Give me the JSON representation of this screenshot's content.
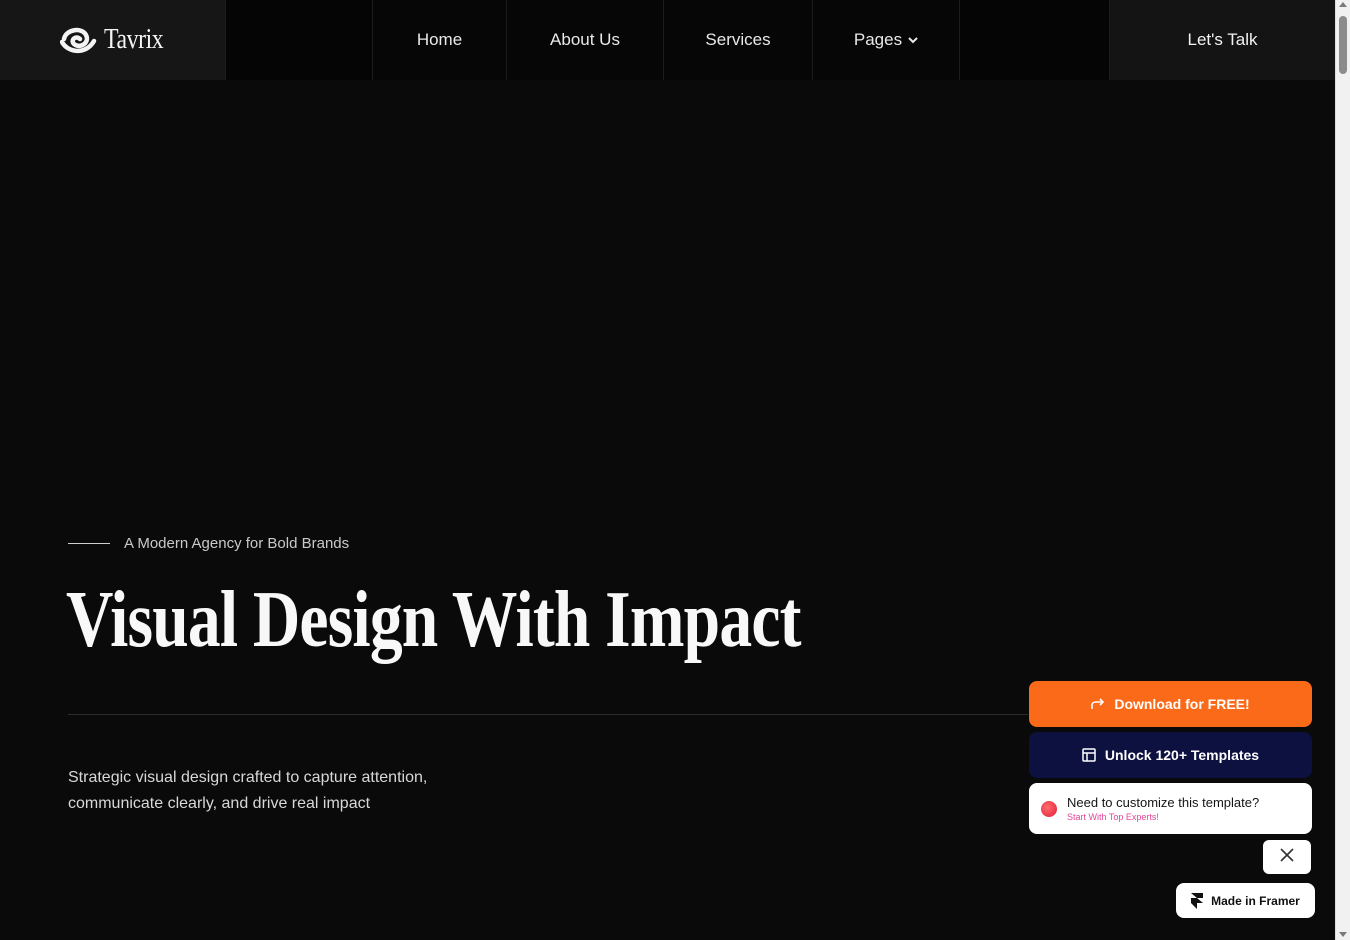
{
  "brand": {
    "name": "Tavrix",
    "logo_icon": "swirl-logo-icon"
  },
  "nav": {
    "items": [
      {
        "label": "Home"
      },
      {
        "label": "About Us"
      },
      {
        "label": "Services"
      },
      {
        "label": "Pages",
        "icon": "chevron-down-icon"
      }
    ],
    "cta_label": "Let's Talk"
  },
  "hero": {
    "eyebrow": "A Modern Agency for Bold Brands",
    "title": "Visual Design With Impact",
    "description": "Strategic visual design crafted to capture attention, communicate clearly, and drive real impact"
  },
  "widgets": {
    "download_label": "Download for FREE!",
    "download_icon": "share-arrow-icon",
    "unlock_label": "Unlock 120+ Templates",
    "unlock_icon": "template-grid-icon",
    "customize_title": "Need to customize this template?",
    "customize_sub": "Start With Top Experts!",
    "close_icon": "close-icon",
    "framer_badge": "Made in Framer",
    "framer_icon": "framer-logo-icon"
  },
  "colors": {
    "background": "#0a0a0a",
    "download_button": "#fb6a18",
    "unlock_button": "#0c1140",
    "customize_subtext": "#e0459a"
  }
}
